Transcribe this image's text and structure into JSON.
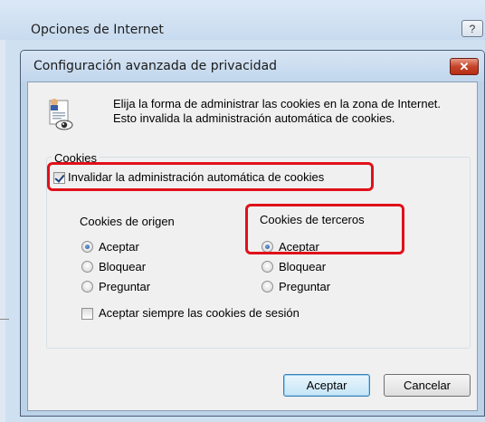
{
  "parent_window": {
    "title": "Opciones de Internet",
    "help_glyph": "?"
  },
  "dialog": {
    "title": "Configuración avanzada de privacidad",
    "close_glyph": "✕",
    "intro_line1": "Elija la forma de administrar las cookies en la zona de Internet.",
    "intro_line2": "Esto invalida la administración automática de cookies.",
    "group_label": "Cookies",
    "override_checkbox": {
      "label": "Invalidar la administración automática de cookies",
      "checked": true
    },
    "first_party": {
      "heading": "Cookies de origen",
      "options": [
        "Aceptar",
        "Bloquear",
        "Preguntar"
      ],
      "selected": "Aceptar"
    },
    "third_party": {
      "heading": "Cookies de terceros",
      "options": [
        "Aceptar",
        "Bloquear",
        "Preguntar"
      ],
      "selected": "Aceptar"
    },
    "session_checkbox": {
      "label": "Aceptar siempre las cookies de sesión",
      "checked": false
    },
    "ok_label": "Aceptar",
    "cancel_label": "Cancelar"
  },
  "colors": {
    "highlight": "#e0101a",
    "close_button": "#c6442a",
    "dialog_background": "#f0f0f0"
  },
  "icons": [
    "document-privacy-icon",
    "eye-icon",
    "close-icon"
  ]
}
